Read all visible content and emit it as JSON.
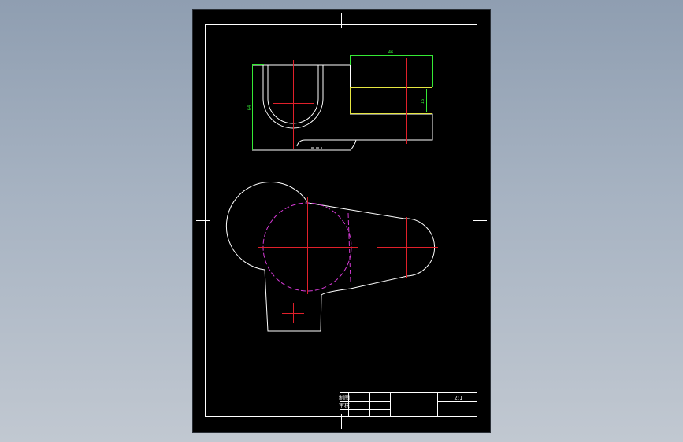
{
  "colors": {
    "background_top": "#8f9eb1",
    "background_bottom": "#c1c8d1",
    "sheet": "#000000",
    "outline": "#ffffff",
    "centerline": "#e0202a",
    "dimension": "#35e935",
    "hidden": "#d53ad5",
    "highlight": "#e6e641"
  },
  "dimensions": {
    "top_width": "46",
    "left_height": "64",
    "slot_height": "16"
  },
  "title_block": {
    "row1_label": "制图",
    "row2_label": "审核",
    "scale": "2:1"
  }
}
